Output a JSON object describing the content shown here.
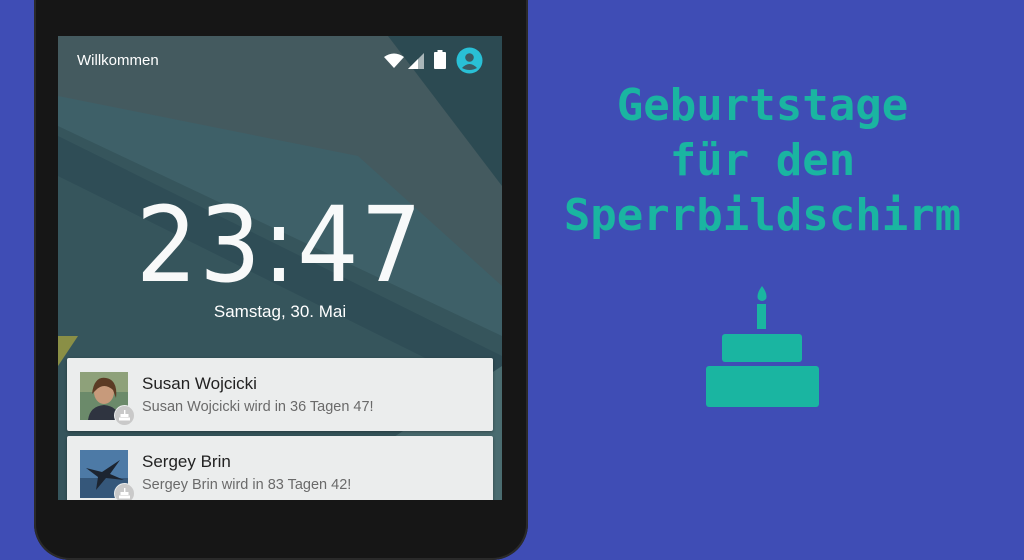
{
  "status_bar": {
    "carrier_text": "Willkommen",
    "icons": [
      "wifi-icon",
      "signal-icon",
      "battery-icon",
      "user-account-icon"
    ]
  },
  "lockscreen": {
    "time": "23:47",
    "date": "Samstag, 30. Mai"
  },
  "notifications": [
    {
      "name": "Susan Wojcicki",
      "message": "Susan Wojcicki wird in 36 Tagen 47!",
      "badge_icon": "cake-icon"
    },
    {
      "name": "Sergey Brin",
      "message": "Sergey Brin wird in 83 Tagen 42!",
      "badge_icon": "cake-icon"
    }
  ],
  "promo": {
    "title_lines": [
      "Geburtstage",
      "für den",
      "Sperrbildschirm"
    ],
    "icon": "cake-icon"
  },
  "colors": {
    "background": "#3f4db5",
    "accent": "#1ab5a1",
    "notification_card": "#ebeded",
    "status_accent": "#29c0d6"
  }
}
